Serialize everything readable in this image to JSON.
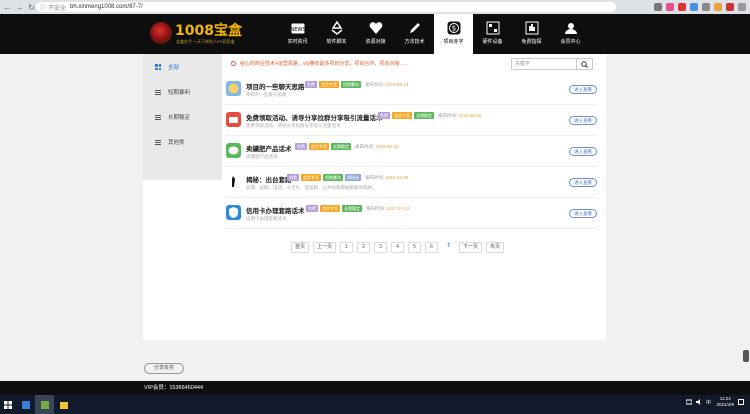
{
  "browser": {
    "secure_label": "不安全",
    "url": "bh.xinmeng1008.com/87-7/"
  },
  "logo": {
    "title": "1008宝盒",
    "subtitle": "宝盒在手 一天干掉别人PC网页盒"
  },
  "nav": [
    {
      "label": "实时资讯",
      "icon": "news-icon"
    },
    {
      "label": "软件脚本",
      "icon": "recycle-icon"
    },
    {
      "label": "资源对接",
      "icon": "handshake-icon"
    },
    {
      "label": "方法技术",
      "icon": "pen-icon"
    },
    {
      "label": "项目赤字",
      "icon": "dollar-icon"
    },
    {
      "label": "硬件设备",
      "icon": "device-icon"
    },
    {
      "label": "免费指探",
      "icon": "hand-icon"
    },
    {
      "label": "会员中心",
      "icon": "user-icon"
    }
  ],
  "sidebar": [
    {
      "label": "全部",
      "active": true
    },
    {
      "label": "短期暴利",
      "active": false
    },
    {
      "label": "长期稳定",
      "active": false
    },
    {
      "label": "其他类",
      "active": false
    }
  ],
  "notice": "秘心的商业技术+运营思路，vip拥有最多项目分享，项目合作，项目对接......",
  "search": {
    "placeholder": "关键字"
  },
  "items": [
    {
      "title": "项目的一些聊天思路",
      "tags": [
        [
          "免费",
          "purple"
        ],
        [
          "会员专享",
          "orange"
        ],
        [
          "短期暴利",
          "green"
        ]
      ],
      "date_label": "发布时间:",
      "date": "2019-06-24",
      "desc": "项目的一些聊天思路",
      "enter": "进入查看",
      "thumb": "#7fb8e8"
    },
    {
      "title": "免费领取活动、诱导分享拉群分享吸引流量话术",
      "tags": [
        [
          "免费",
          "purple"
        ],
        [
          "会员专享",
          "orange"
        ],
        [
          "长期稳定",
          "green"
        ]
      ],
      "date_label": "发布时间:",
      "date": "2019-06-22",
      "desc": "免费领取活动、诱导分享拉群分享吸引流量话术",
      "enter": "进入查看",
      "thumb": "#e54d42"
    },
    {
      "title": "卖罐肥产品话术",
      "tags": [
        [
          "免费",
          "purple"
        ],
        [
          "会员专享",
          "orange"
        ],
        [
          "长期稳定",
          "green"
        ]
      ],
      "date_label": "发布时间:",
      "date": "2019-06-20",
      "desc": "卖罐肥产品话术",
      "enter": "进入查看",
      "thumb": "#5cb85c"
    },
    {
      "title": "揭秘：出台套路",
      "tags": [
        [
          "免费",
          "purple"
        ],
        [
          "会员专享",
          "orange"
        ],
        [
          "短期暴利",
          "green"
        ],
        [
          "揭秘秘",
          "blue"
        ]
      ],
      "date_label": "发布时间:",
      "date": "2019-03-06",
      "desc": "前期、前期、电话、小卡片、电话剧、公共局和都被套路的陷阱。",
      "enter": "进入查看",
      "thumb": "#ffffff"
    },
    {
      "title": "信用卡办理套路话术",
      "tags": [
        [
          "免费",
          "purple"
        ],
        [
          "会员专享",
          "orange"
        ],
        [
          "长期稳定",
          "green"
        ]
      ],
      "date_label": "发布时间:",
      "date": "2017-07-12",
      "desc": "信用卡办理套路话术",
      "enter": "进入查看",
      "thumb": "#2a8ad8"
    }
  ],
  "pager": [
    "首页",
    "上一页",
    "1",
    "2",
    "3",
    "4",
    "5",
    "6",
    "7",
    "下一页",
    "末页"
  ],
  "pager_current": "7",
  "share": "分享有奖",
  "footer": "VIP会员：15366460444",
  "clock": {
    "time": "11:24",
    "date": "2021/4/9"
  },
  "colors": {
    "accent": "#2a7ae2",
    "header": "#0e0e0e",
    "notice": "#e06030"
  }
}
